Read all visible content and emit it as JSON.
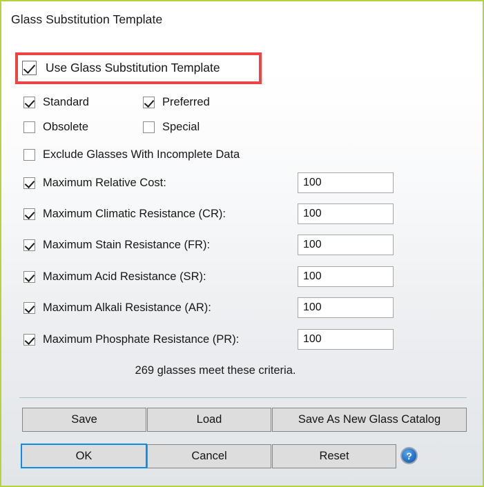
{
  "dialog": {
    "title": "Glass Substitution Template",
    "border_color": "#b5d33d",
    "highlight_color": "#ef4444",
    "accent_color": "#0c8ce9"
  },
  "master_checkbox": {
    "label": "Use Glass Substitution Template",
    "checked": true
  },
  "category_checkboxes": [
    {
      "label": "Standard",
      "checked": true
    },
    {
      "label": "Preferred",
      "checked": true
    },
    {
      "label": "Obsolete",
      "checked": false
    },
    {
      "label": "Special",
      "checked": false
    }
  ],
  "exclude_checkbox": {
    "label": "Exclude Glasses With Incomplete Data",
    "checked": false
  },
  "criteria_rows": [
    {
      "label": "Maximum Relative Cost:",
      "checked": true,
      "value": "100"
    },
    {
      "label": "Maximum Climatic Resistance (CR):",
      "checked": true,
      "value": "100"
    },
    {
      "label": "Maximum Stain Resistance (FR):",
      "checked": true,
      "value": "100"
    },
    {
      "label": "Maximum Acid Resistance (SR):",
      "checked": true,
      "value": "100"
    },
    {
      "label": "Maximum Alkali Resistance (AR):",
      "checked": true,
      "value": "100"
    },
    {
      "label": "Maximum Phosphate Resistance (PR):",
      "checked": true,
      "value": "100"
    }
  ],
  "status": {
    "text": "269 glasses meet these criteria.",
    "count": 269
  },
  "buttons": {
    "save": "Save",
    "load": "Load",
    "save_as_new_glass_catalog": "Save As New Glass Catalog",
    "ok": "OK",
    "cancel": "Cancel",
    "reset": "Reset"
  },
  "help": {
    "icon": "help-icon",
    "glyph": "?"
  }
}
